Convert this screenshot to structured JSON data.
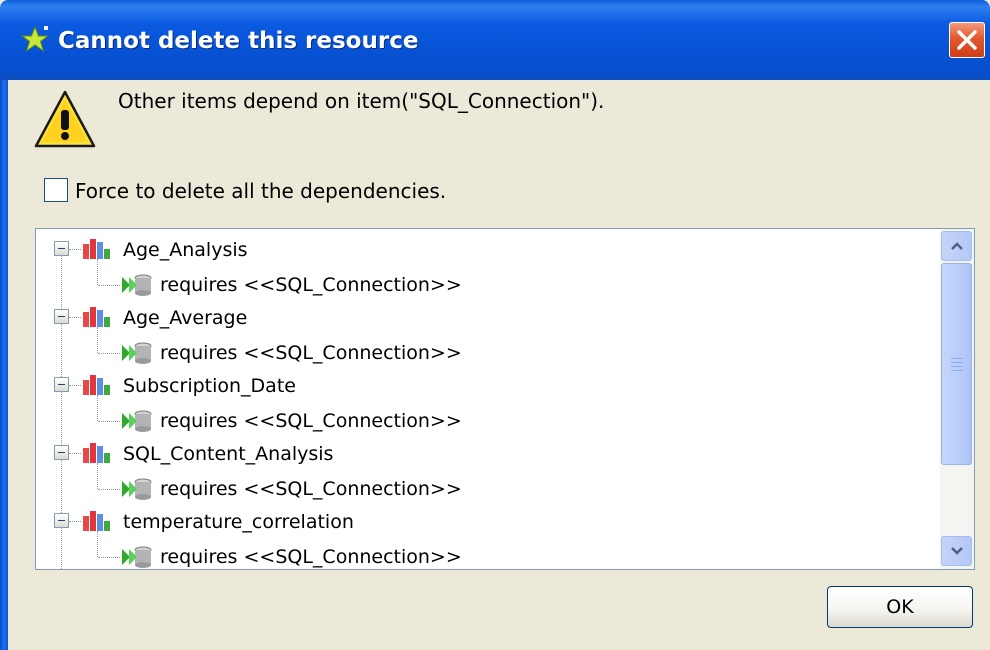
{
  "dialog": {
    "title": "Cannot delete this resource",
    "message": "Other items depend on item(\"SQL_Connection\").",
    "force_label": "Force to delete all the dependencies.",
    "force_checked": false,
    "ok_label": "OK"
  },
  "tree": {
    "items": [
      {
        "label": "Age_Analysis",
        "dependency": "requires <<SQL_Connection>>"
      },
      {
        "label": "Age_Average",
        "dependency": "requires <<SQL_Connection>>"
      },
      {
        "label": "Subscription_Date",
        "dependency": "requires <<SQL_Connection>>"
      },
      {
        "label": "SQL_Content_Analysis",
        "dependency": "requires <<SQL_Connection>>"
      },
      {
        "label": "temperature_correlation",
        "dependency": "requires <<SQL_Connection>>"
      }
    ]
  },
  "icons": {
    "title": "star-icon",
    "close": "close-icon",
    "warning": "warning-icon",
    "node": "bar-chart-icon",
    "dependency": "database-connection-icon"
  },
  "colors": {
    "title_bar": "#0a5ae0",
    "dialog_bg": "#ece9d8",
    "close_button": "#e3582f"
  }
}
